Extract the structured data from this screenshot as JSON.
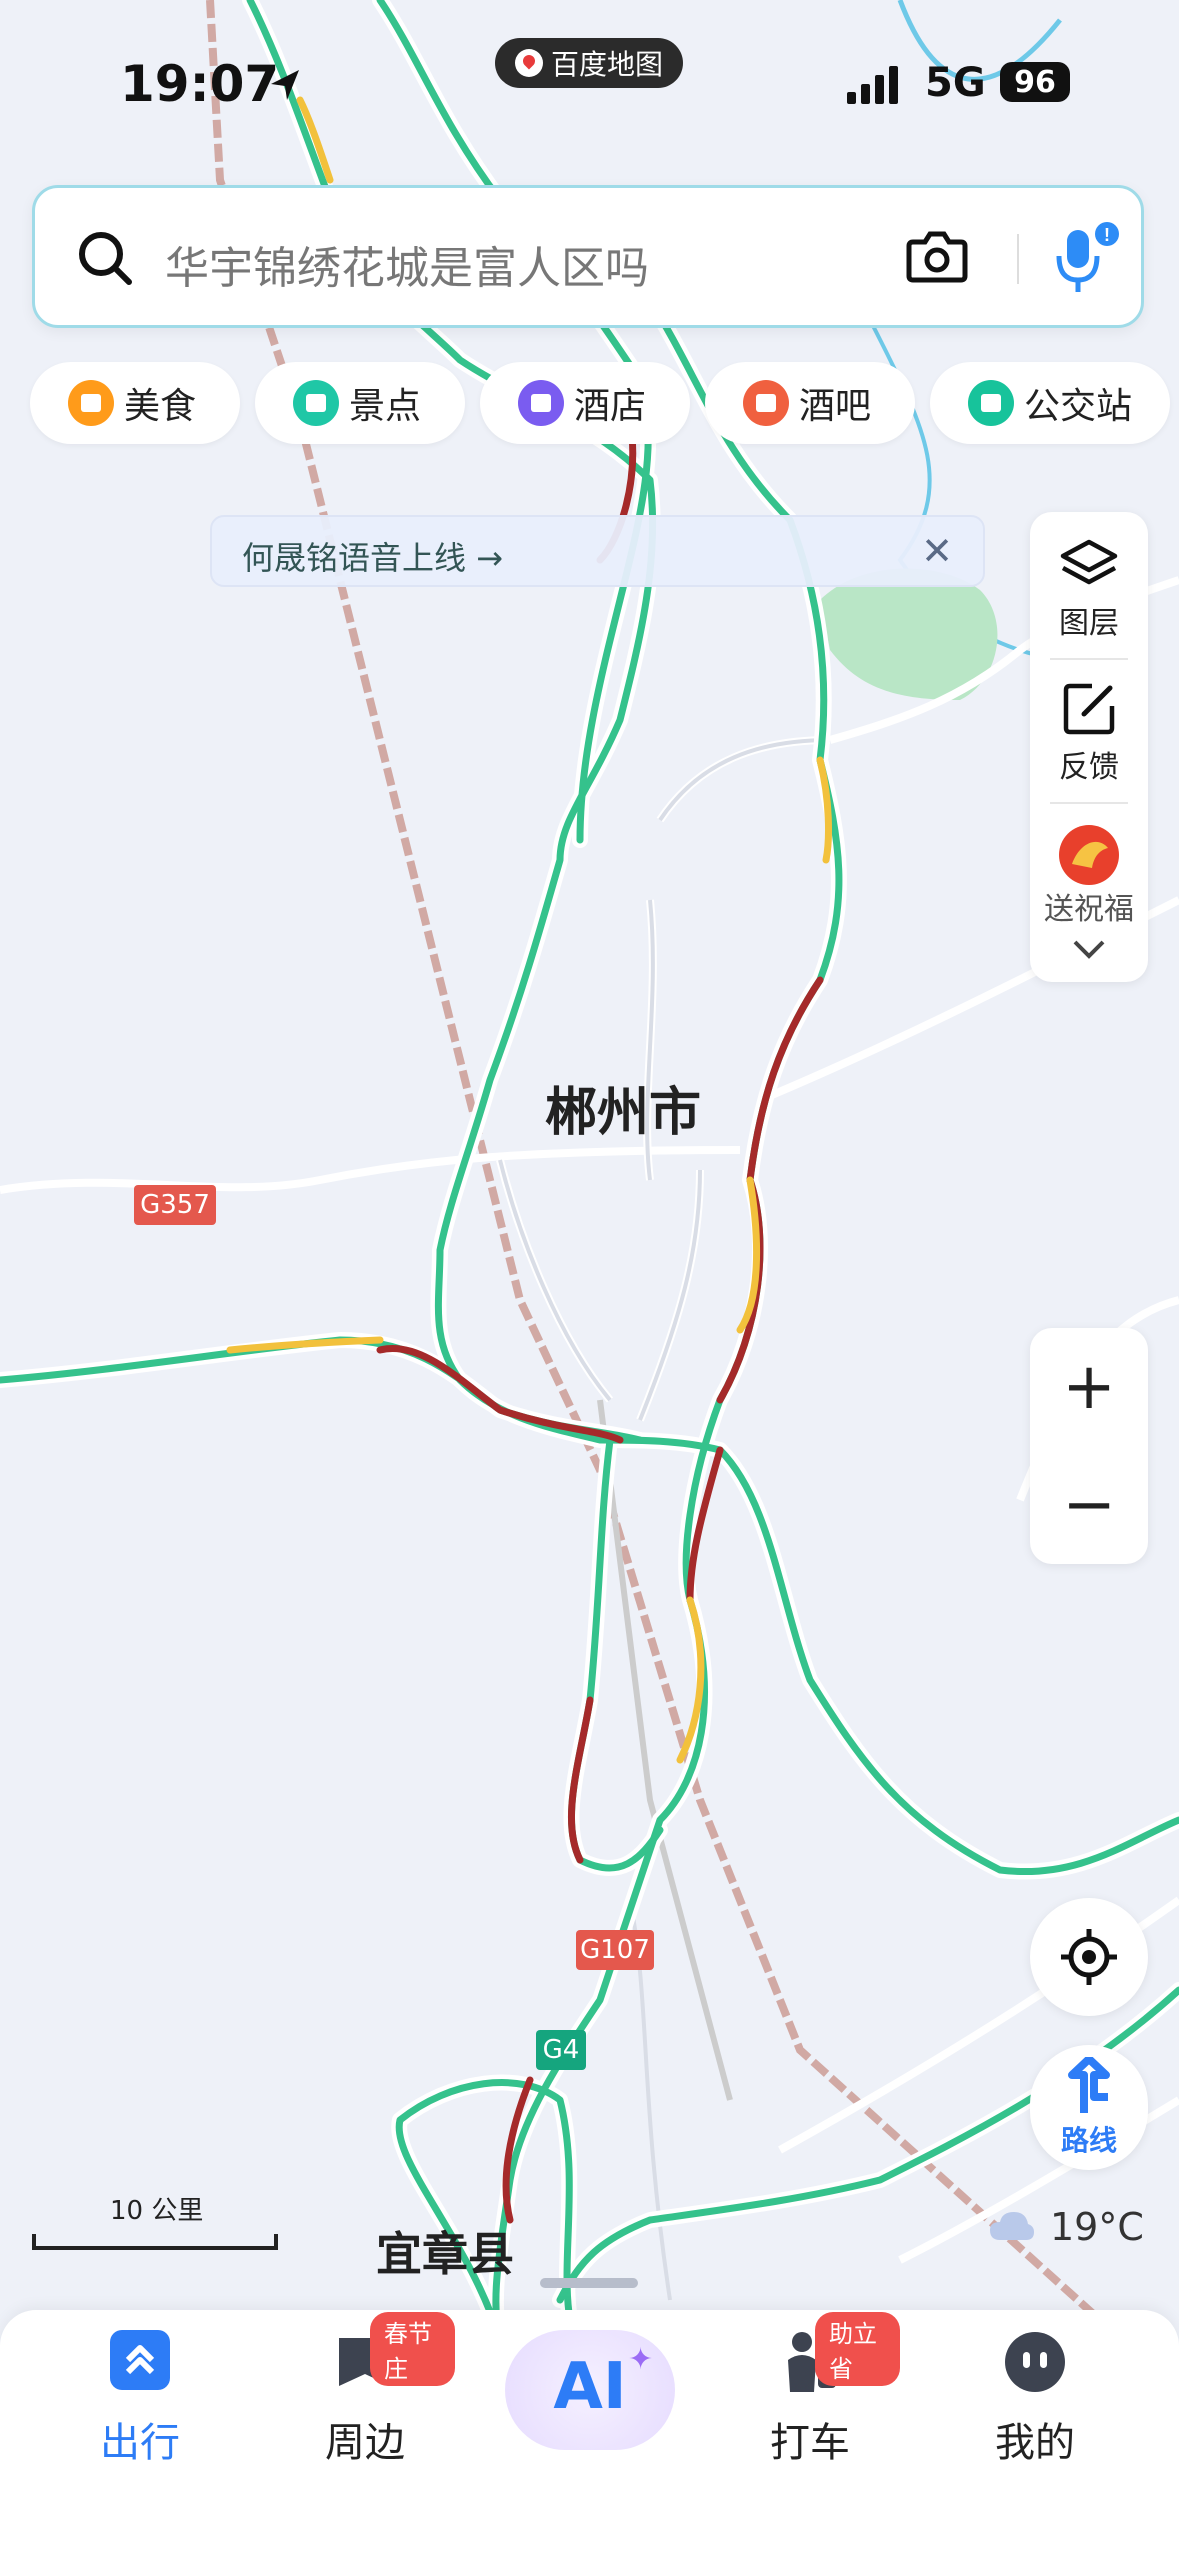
{
  "status_bar": {
    "time": "19:07",
    "app_pill": "百度地图",
    "network": "5G",
    "battery": "96"
  },
  "search": {
    "placeholder": "华宇锦绣花城是富人区吗"
  },
  "categories": [
    {
      "label": "美食",
      "icon": "food-icon",
      "color": "#ff9b1a"
    },
    {
      "label": "景点",
      "icon": "scenic-icon",
      "color": "#1fc7a6"
    },
    {
      "label": "酒店",
      "icon": "hotel-icon",
      "color": "#7a5cf0"
    },
    {
      "label": "酒吧",
      "icon": "bar-icon",
      "color": "#f0603f"
    },
    {
      "label": "公交站",
      "icon": "bus-stop-icon",
      "color": "#17c39b"
    }
  ],
  "banner": {
    "text": "何晟铭语音上线 →"
  },
  "right_tools": {
    "layers": "图层",
    "feedback": "反馈",
    "blessing": "送祝福"
  },
  "map": {
    "city": "郴州市",
    "county": "宜章县",
    "shields": [
      {
        "label": "G357",
        "color": "#e4584d"
      },
      {
        "label": "G107",
        "color": "#e4584d"
      },
      {
        "label": "G4",
        "color": "#15a57e"
      }
    ],
    "scale": "10 公里"
  },
  "weather": {
    "temp": "19°C"
  },
  "tabbar": [
    {
      "label": "出行",
      "active": true,
      "badge": ""
    },
    {
      "label": "周边",
      "active": false,
      "badge": "春节庄"
    },
    {
      "label": "AI",
      "active": false,
      "badge": ""
    },
    {
      "label": "打车",
      "active": false,
      "badge": "助立省"
    },
    {
      "label": "我的",
      "active": false,
      "badge": ""
    }
  ],
  "colors": {
    "accent": "#2d7cf6",
    "road_green": "#35c28c",
    "road_red": "#a52a2a",
    "road_yellow": "#f2c13c"
  }
}
